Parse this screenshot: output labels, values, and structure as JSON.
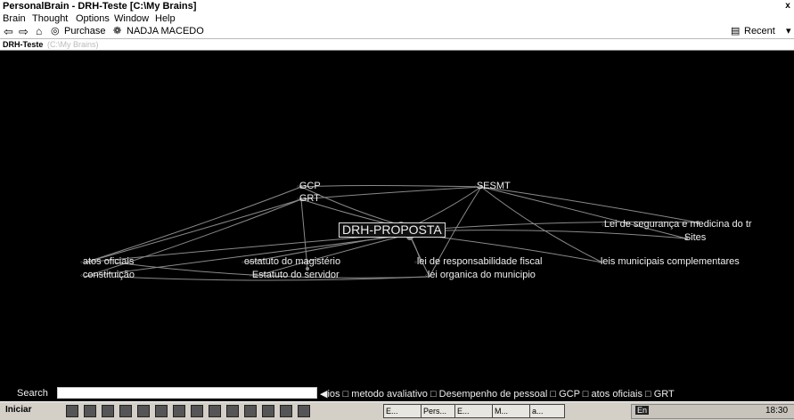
{
  "window": {
    "title": "PersonalBrain - DRH-Teste [C:\\My Brains]",
    "close": "x"
  },
  "menu": [
    "Brain",
    "Thought",
    "Options",
    "Window",
    "Help"
  ],
  "toolbar": {
    "purchase": "Purchase",
    "user": "NADJA MACEDO",
    "recent": "Recent"
  },
  "tab": {
    "name": "DRH-Teste",
    "path": "(C:\\My Brains)"
  },
  "central_thought": "DRH-PROPOSTA",
  "nodes": {
    "gcp": "GCP",
    "grt": "GRT",
    "sesmt": "SESMT",
    "lei_seg": "Lei de segurança e medicina do tr",
    "sites": "Sites",
    "atos": "atos oficiais",
    "constituicao": "constituição",
    "estatuto_mag": "estatuto do magistério",
    "estatuto_serv": "Estatuto do servidor",
    "lei_resp": "lei de responsabilidade fiscal",
    "lei_org": "lei organica do municipio",
    "leis_mun": "leis municipais complementares"
  },
  "search": {
    "label": "Search",
    "value": ""
  },
  "recent_thoughts": "◀ios  □ metodo avaliativo  □ Desempenho de pessoal  □ GCP  □ atos oficiais  □ GRT",
  "taskbar": {
    "start": "Iniciar",
    "tasks": [
      "E...",
      "Pers...",
      "E...",
      "M...",
      "a..."
    ],
    "clock": "18:30",
    "lang": "En"
  },
  "colors": {
    "canvas": "#000000",
    "links": "#8a8a8a",
    "node_text": "#f0f0f0"
  }
}
